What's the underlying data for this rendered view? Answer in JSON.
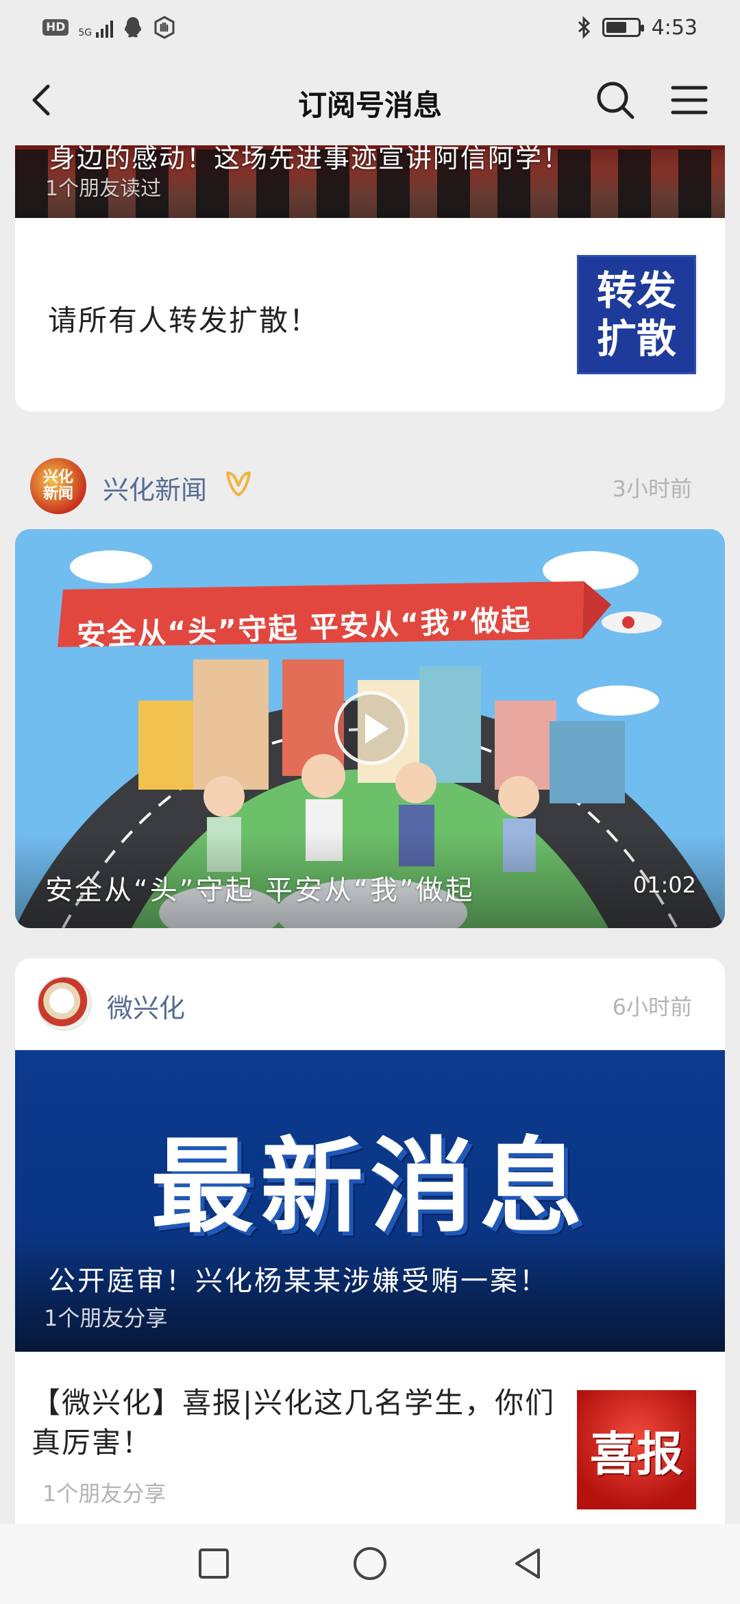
{
  "status_bar": {
    "hd": "HD",
    "network": "5G",
    "time": "4:53",
    "battery_level": 0.65
  },
  "nav": {
    "title": "订阅号消息",
    "icons": [
      "back-icon",
      "search-icon",
      "menu-icon"
    ]
  },
  "card1": {
    "banner_title": "身边的感动！这场先进事迹宣讲阿信阿学！",
    "banner_sub": "1个朋友读过",
    "item_text": "请所有人转发扩散！",
    "thumb_line1": "转发",
    "thumb_line2": "扩散"
  },
  "account2": {
    "avatar_text": "兴化新闻",
    "name": "兴化新闻",
    "time": "3小时前"
  },
  "video": {
    "banner_text": "安全从“头”守起  平安从“我”做起",
    "title": "安全从“头”守起 平安从“我”做起",
    "duration": "01:02"
  },
  "account3": {
    "name": "微兴化",
    "time": "6小时前",
    "hero_text": "最新消息",
    "hero_title": "公开庭审！兴化杨某某涉嫌受贿一案！",
    "hero_sub": "1个朋友分享",
    "item_text": "【微兴化】喜报|兴化这几名学生，你们真厉害！",
    "item_sub": "1个朋友分享",
    "thumb_text": "喜报"
  },
  "colors": {
    "background": "#ededed",
    "account_name": "#566b94",
    "muted": "#b3b3b3",
    "hero_blue": "#0c3a8e"
  }
}
